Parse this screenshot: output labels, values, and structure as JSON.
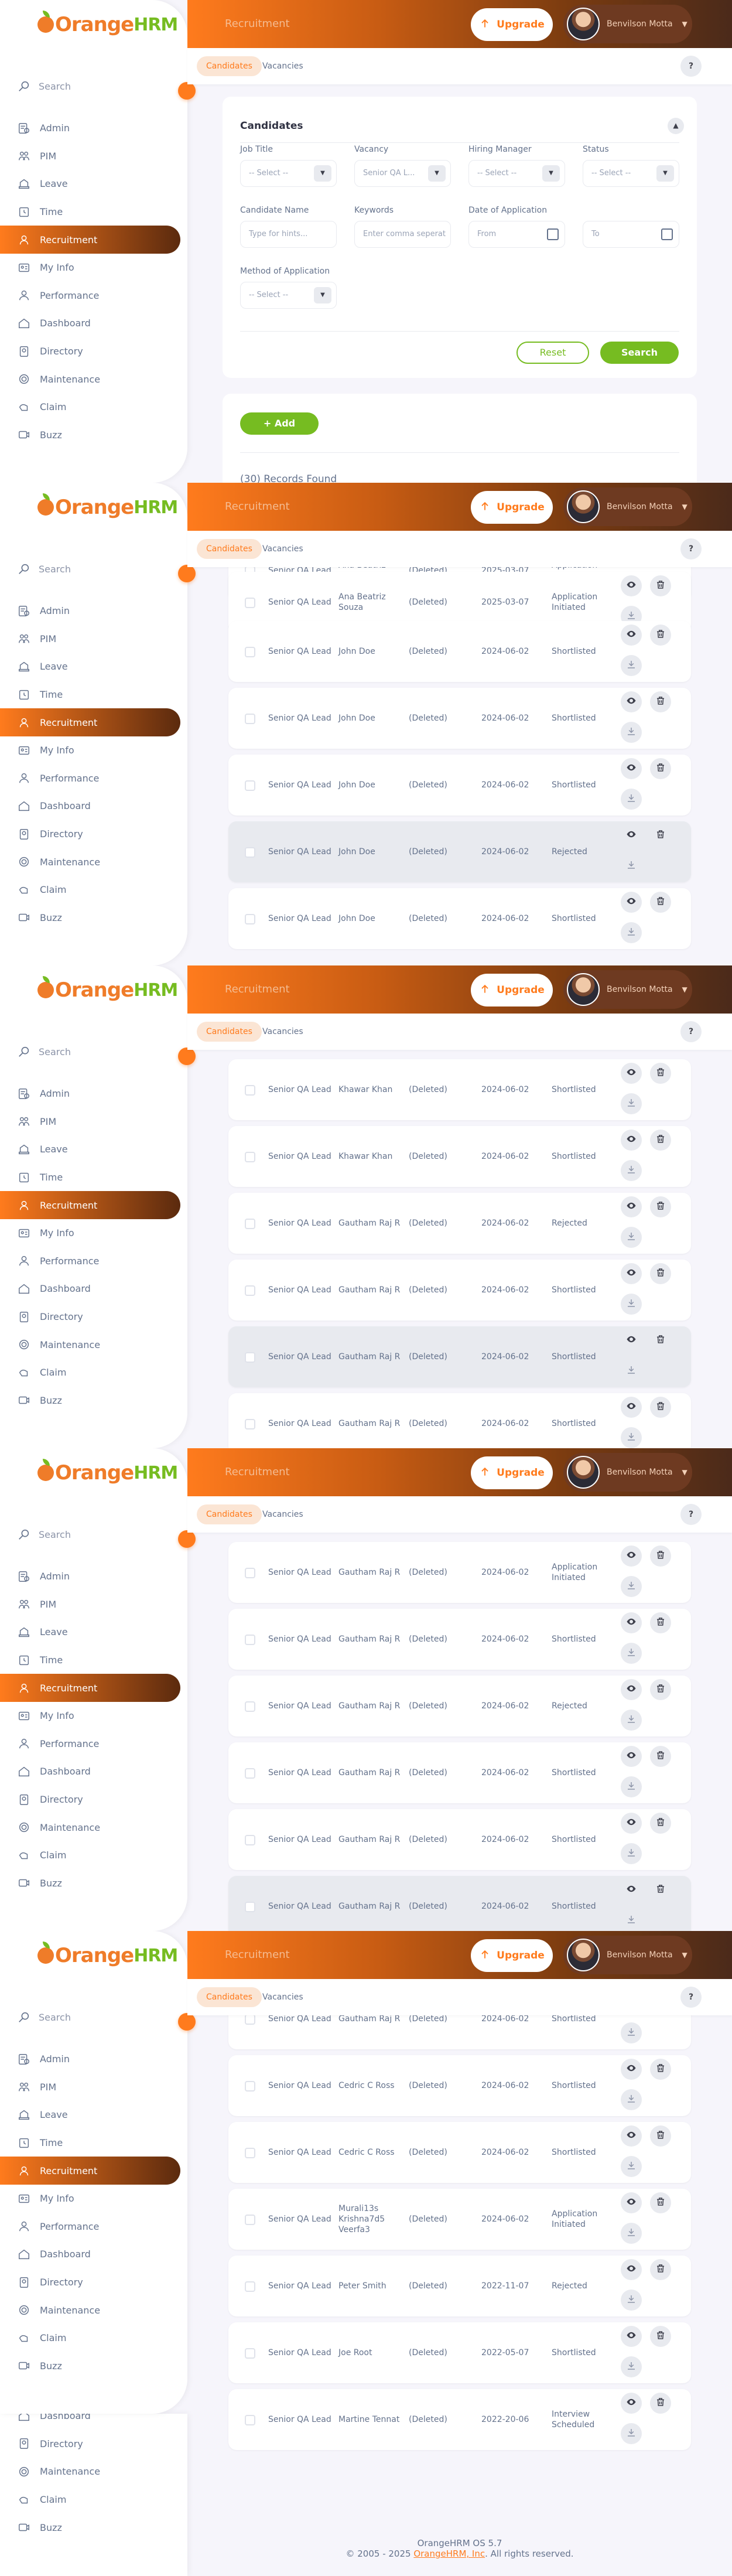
{
  "app": {
    "logo_main": "Orange",
    "logo_suffix": "HRM",
    "search_placeholder": "Search",
    "topbar_title": "Recruitment",
    "upgrade_label": "Upgrade",
    "user_name": "Benvilson Motta",
    "help_label": "?",
    "brand_colors": {
      "accent": "#ff7b1d",
      "success": "#76bc21",
      "text": "#64728c"
    }
  },
  "sidebar": {
    "items": [
      {
        "label": "Admin",
        "icon": "admin-icon"
      },
      {
        "label": "PIM",
        "icon": "pim-icon"
      },
      {
        "label": "Leave",
        "icon": "leave-icon"
      },
      {
        "label": "Time",
        "icon": "time-icon"
      },
      {
        "label": "Recruitment",
        "icon": "recruitment-icon",
        "active": true
      },
      {
        "label": "My Info",
        "icon": "my-info-icon"
      },
      {
        "label": "Performance",
        "icon": "performance-icon"
      },
      {
        "label": "Dashboard",
        "icon": "dashboard-icon"
      },
      {
        "label": "Directory",
        "icon": "directory-icon"
      },
      {
        "label": "Maintenance",
        "icon": "maintenance-icon"
      },
      {
        "label": "Claim",
        "icon": "claim-icon"
      },
      {
        "label": "Buzz",
        "icon": "buzz-icon"
      }
    ],
    "bottom_partial": [
      "Dashboard",
      "Directory",
      "Maintenance",
      "Claim",
      "Buzz"
    ]
  },
  "tabs": [
    {
      "label": "Candidates",
      "active": true
    },
    {
      "label": "Vacancies",
      "active": false
    }
  ],
  "filter": {
    "title": "Candidates",
    "job_title_label": "Job Title",
    "job_title_value": "-- Select --",
    "vacancy_label": "Vacancy",
    "vacancy_value": "Senior QA L...",
    "hiring_manager_label": "Hiring Manager",
    "hiring_manager_value": "-- Select --",
    "status_label": "Status",
    "status_value": "-- Select --",
    "candidate_name_label": "Candidate Name",
    "candidate_name_placeholder": "Type for hints...",
    "keywords_label": "Keywords",
    "keywords_placeholder": "Enter comma seperat",
    "date_label": "Date of Application",
    "date_from_placeholder": "From",
    "date_to_placeholder": "To",
    "method_label": "Method of Application",
    "method_value": "-- Select --",
    "reset_label": "Reset",
    "search_label": "Search"
  },
  "list": {
    "add_label": "+ Add",
    "records_found": "(30) Records Found"
  },
  "rows": [
    {
      "vacancy": "Senior QA Lead",
      "candidate": "Ana Beatriz Souza",
      "manager": "(Deleted)",
      "date": "2025-03-07",
      "status": "Application Initiated"
    },
    {
      "vacancy": "Senior QA Lead",
      "candidate": "Ana Beatriz Souza",
      "manager": "(Deleted)",
      "date": "2025-03-07",
      "status": "Application Initiated"
    },
    {
      "vacancy": "Senior QA Lead",
      "candidate": "John Doe",
      "manager": "(Deleted)",
      "date": "2024-06-02",
      "status": "Shortlisted"
    },
    {
      "vacancy": "Senior QA Lead",
      "candidate": "John Doe",
      "manager": "(Deleted)",
      "date": "2024-06-02",
      "status": "Shortlisted"
    },
    {
      "vacancy": "Senior QA Lead",
      "candidate": "John Doe",
      "manager": "(Deleted)",
      "date": "2024-06-02",
      "status": "Shortlisted"
    },
    {
      "vacancy": "Senior QA Lead",
      "candidate": "John Doe",
      "manager": "(Deleted)",
      "date": "2024-06-02",
      "status": "Rejected"
    },
    {
      "vacancy": "Senior QA Lead",
      "candidate": "John Doe",
      "manager": "(Deleted)",
      "date": "2024-06-02",
      "status": "Shortlisted"
    },
    {
      "vacancy": "Senior QA Lead",
      "candidate": "Khawar Khan",
      "manager": "(Deleted)",
      "date": "2024-06-02",
      "status": "Shortlisted"
    },
    {
      "vacancy": "Senior QA Lead",
      "candidate": "Khawar Khan",
      "manager": "(Deleted)",
      "date": "2024-06-02",
      "status": "Shortlisted"
    },
    {
      "vacancy": "Senior QA Lead",
      "candidate": "Gautham Raj R",
      "manager": "(Deleted)",
      "date": "2024-06-02",
      "status": "Rejected"
    },
    {
      "vacancy": "Senior QA Lead",
      "candidate": "Gautham Raj R",
      "manager": "(Deleted)",
      "date": "2024-06-02",
      "status": "Shortlisted"
    },
    {
      "vacancy": "Senior QA Lead",
      "candidate": "Gautham Raj R",
      "manager": "(Deleted)",
      "date": "2024-06-02",
      "status": "Shortlisted"
    },
    {
      "vacancy": "Senior QA Lead",
      "candidate": "Gautham Raj R",
      "manager": "(Deleted)",
      "date": "2024-06-02",
      "status": "Shortlisted"
    },
    {
      "vacancy": "Senior QA Lead",
      "candidate": "Gautham Raj R",
      "manager": "(Deleted)",
      "date": "2024-06-02",
      "status": "Application Initiated"
    },
    {
      "vacancy": "Senior QA Lead",
      "candidate": "Gautham Raj R",
      "manager": "(Deleted)",
      "date": "2024-06-02",
      "status": "Shortlisted"
    },
    {
      "vacancy": "Senior QA Lead",
      "candidate": "Gautham Raj R",
      "manager": "(Deleted)",
      "date": "2024-06-02",
      "status": "Rejected"
    },
    {
      "vacancy": "Senior QA Lead",
      "candidate": "Gautham Raj R",
      "manager": "(Deleted)",
      "date": "2024-06-02",
      "status": "Shortlisted"
    },
    {
      "vacancy": "Senior QA Lead",
      "candidate": "Gautham Raj R",
      "manager": "(Deleted)",
      "date": "2024-06-02",
      "status": "Shortlisted"
    },
    {
      "vacancy": "Senior QA Lead",
      "candidate": "Gautham Raj R",
      "manager": "(Deleted)",
      "date": "2024-06-02",
      "status": "Shortlisted"
    },
    {
      "vacancy": "Senior QA Lead",
      "candidate": "Gautham Raj R",
      "manager": "(Deleted)",
      "date": "2024-06-02",
      "status": "Shortlisted"
    },
    {
      "vacancy": "Senior QA Lead",
      "candidate": "Cedric C Ross",
      "manager": "(Deleted)",
      "date": "2024-06-02",
      "status": "Shortlisted"
    },
    {
      "vacancy": "Senior QA Lead",
      "candidate": "Cedric C Ross",
      "manager": "(Deleted)",
      "date": "2024-06-02",
      "status": "Shortlisted"
    },
    {
      "vacancy": "Senior QA Lead",
      "candidate": "Murali13s Krishna7d5 Veerfa3",
      "manager": "(Deleted)",
      "date": "2024-06-02",
      "status": "Application Initiated"
    },
    {
      "vacancy": "Senior QA Lead",
      "candidate": "Peter Smith",
      "manager": "(Deleted)",
      "date": "2022-11-07",
      "status": "Rejected"
    },
    {
      "vacancy": "Senior QA Lead",
      "candidate": "Joe Root",
      "manager": "(Deleted)",
      "date": "2022-05-07",
      "status": "Shortlisted"
    },
    {
      "vacancy": "Senior QA Lead",
      "candidate": "Martine Tennat",
      "manager": "(Deleted)",
      "date": "2022-20-06",
      "status": "Interview Scheduled"
    }
  ],
  "footer": {
    "version": "OrangeHRM OS 5.7",
    "copyright_prefix": "© 2005 - 2025 ",
    "company_link": "OrangeHRM, Inc",
    "copyright_suffix": ". All rights reserved."
  }
}
